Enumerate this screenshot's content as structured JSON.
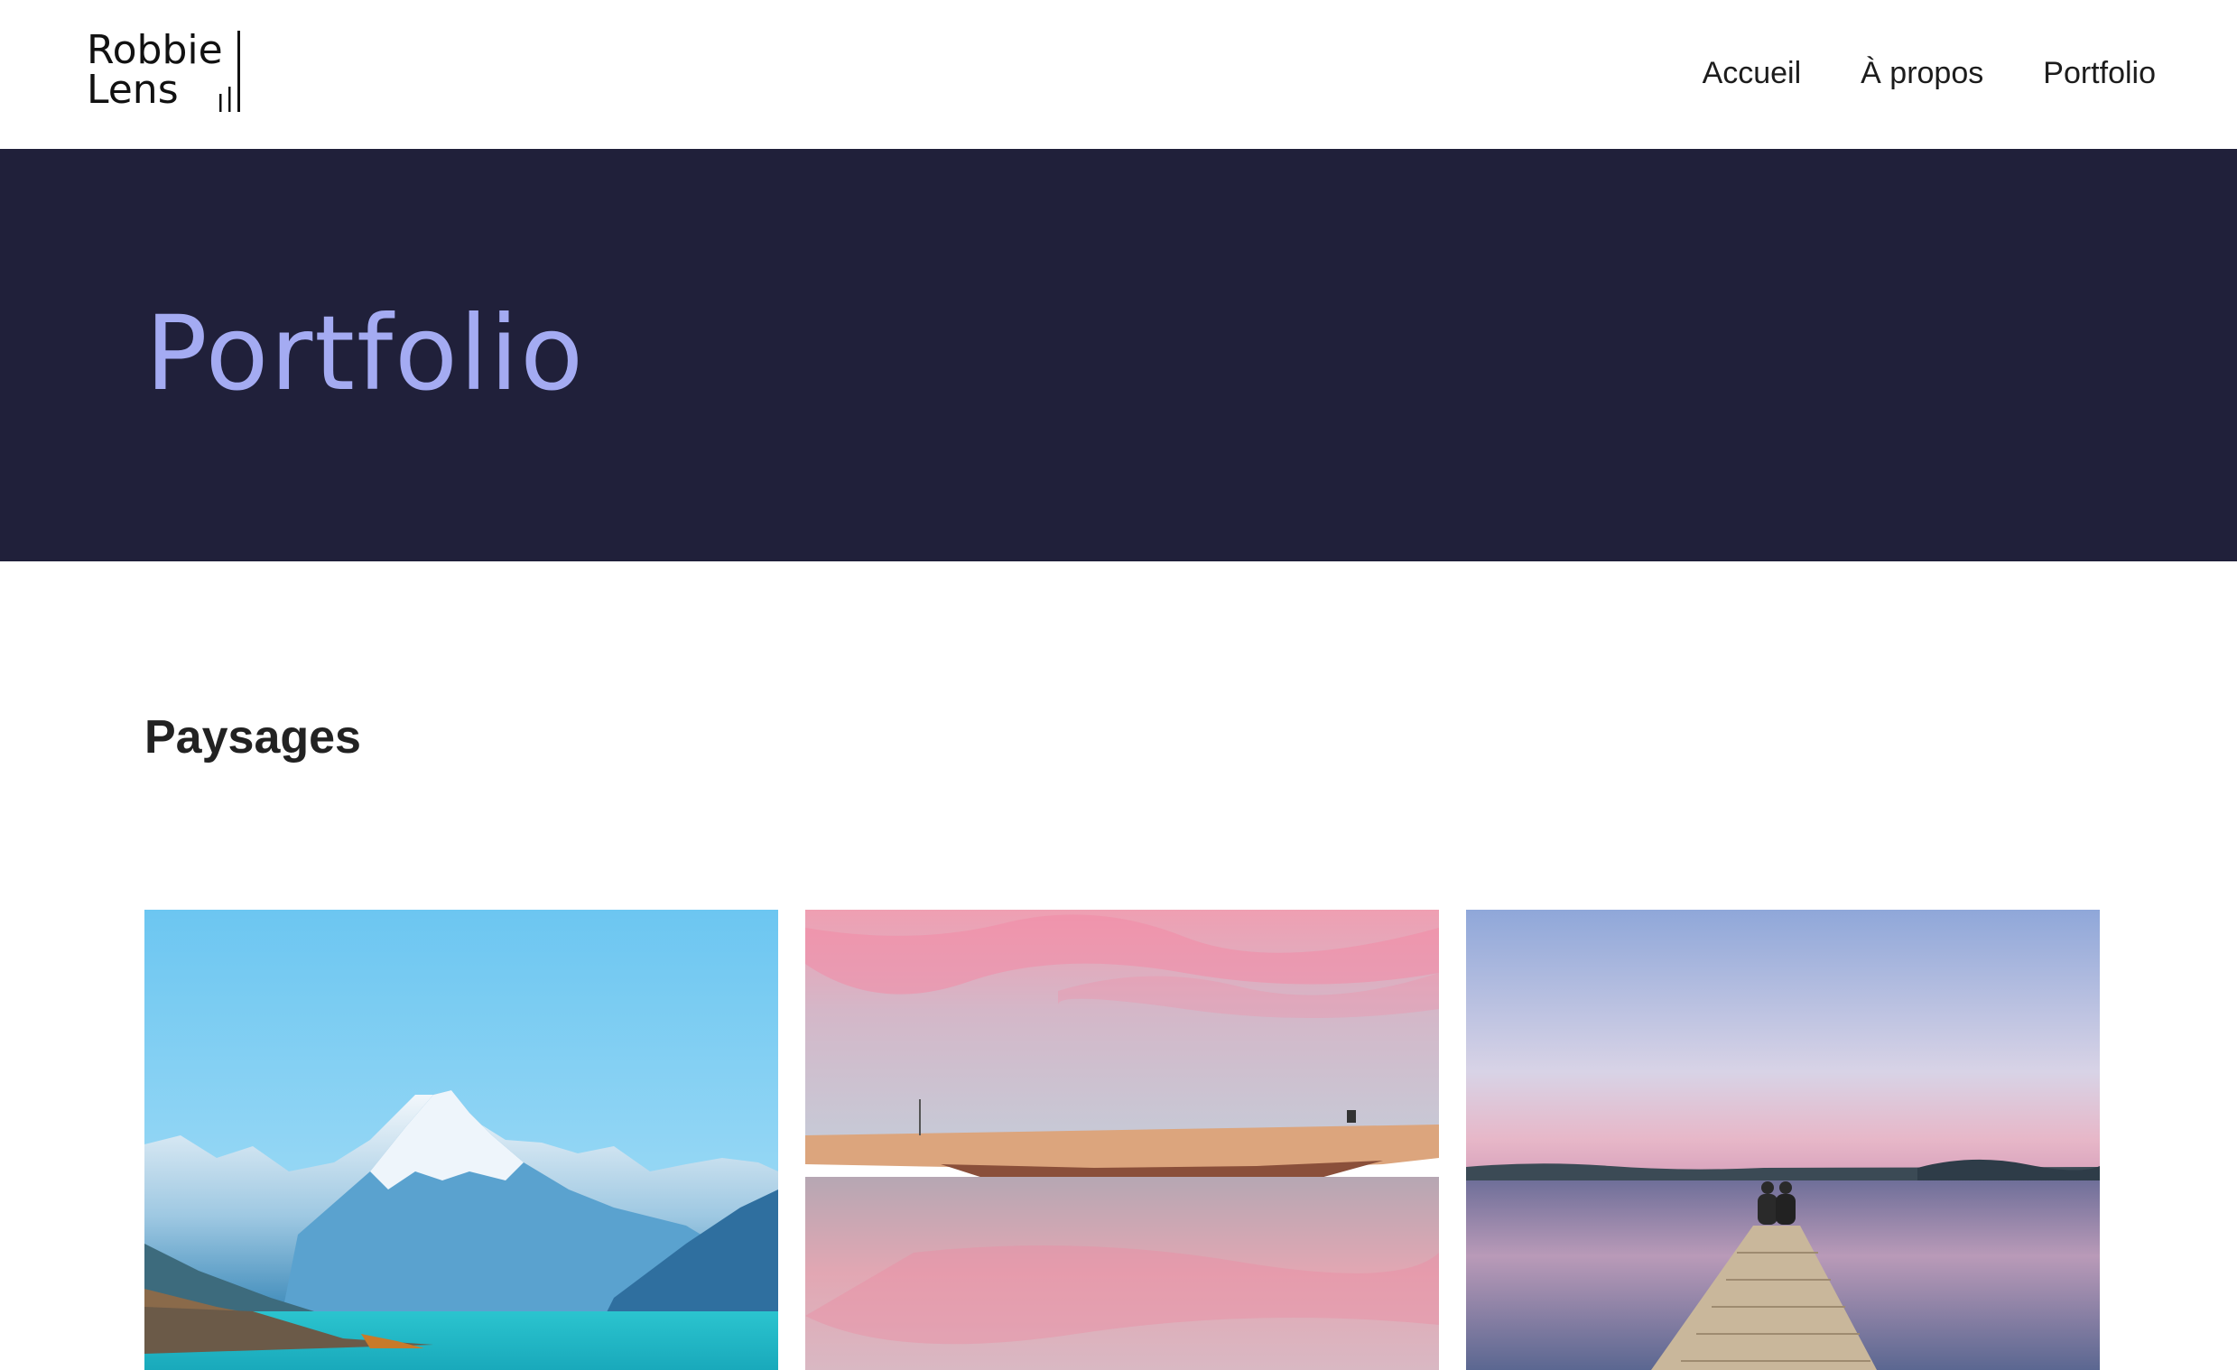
{
  "brand": {
    "logo_line1": "Robbie",
    "logo_line2": "Lens"
  },
  "nav": {
    "items": [
      {
        "label": "Accueil"
      },
      {
        "label": "À propos"
      },
      {
        "label": "Portfolio"
      }
    ]
  },
  "hero": {
    "title": "Portfolio",
    "background": "#20203a",
    "title_color": "#a4abf2"
  },
  "section": {
    "title": "Paysages"
  },
  "gallery": {
    "photos": [
      {
        "subject": "snowy mountain above turquoise lake"
      },
      {
        "subject": "pink sunset sky reflected over sandbar"
      },
      {
        "subject": "two people sitting at end of wooden pier at dusk"
      }
    ]
  }
}
